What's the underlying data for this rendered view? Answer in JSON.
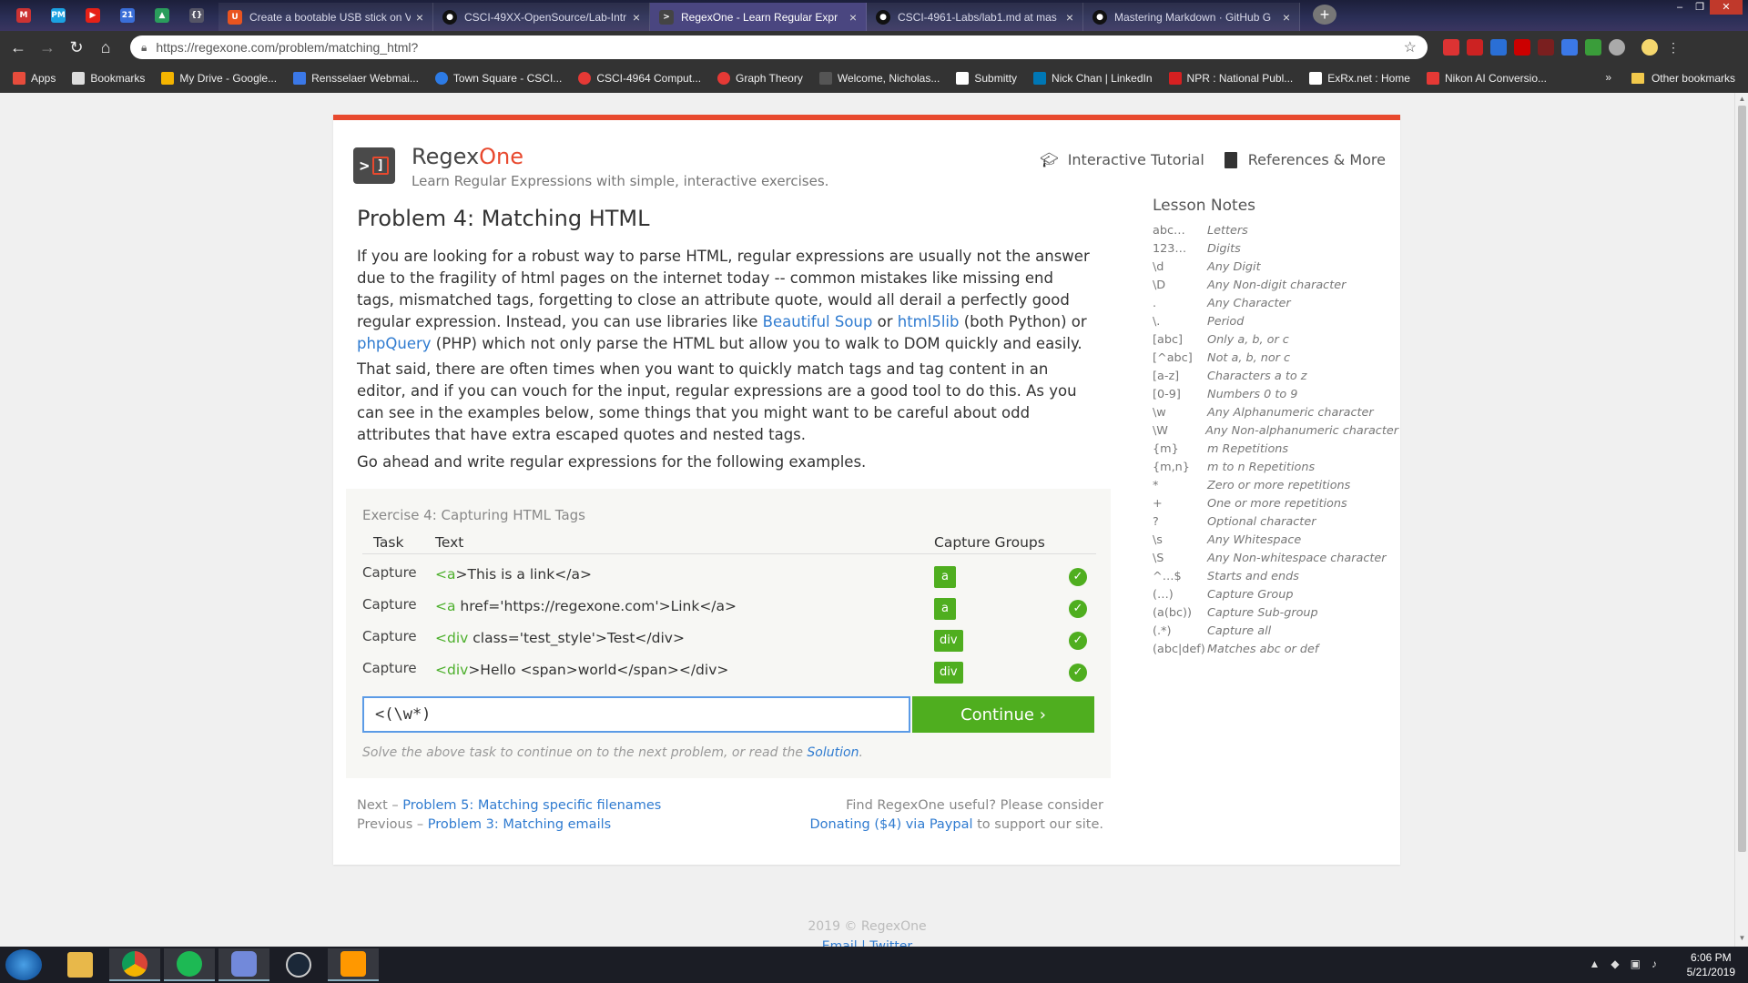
{
  "browser": {
    "tabs": [
      {
        "title": "Create a bootable USB stick on V"
      },
      {
        "title": "CSCI-49XX-OpenSource/Lab-Intr"
      },
      {
        "title": "RegexOne - Learn Regular Expr"
      },
      {
        "title": "CSCI-4961-Labs/lab1.md at mas"
      },
      {
        "title": "Mastering Markdown · GitHub G"
      }
    ],
    "pinned": [
      {
        "icon": "gmail-icon",
        "label": ""
      },
      {
        "icon": "pm-icon",
        "label": "PM"
      },
      {
        "icon": "youtube-icon",
        "label": ""
      },
      {
        "icon": "calendar-icon",
        "label": "21"
      },
      {
        "icon": "drive-icon",
        "label": ""
      },
      {
        "icon": "extension-icon",
        "label": ""
      }
    ],
    "url": "https://regexone.com/problem/matching_html?",
    "bookmarks": [
      {
        "label": "Apps",
        "color": "#e74c3c"
      },
      {
        "label": "Bookmarks",
        "color": "#dddddd"
      },
      {
        "label": "My Drive - Google...",
        "color": "#f4b400"
      },
      {
        "label": "Rensselaer Webmai...",
        "color": "#3b78e7"
      },
      {
        "label": "Town Square - CSCI...",
        "color": "#2d7be5"
      },
      {
        "label": "CSCI-4964 Comput...",
        "color": "#e53935"
      },
      {
        "label": "Graph Theory",
        "color": "#e53935"
      },
      {
        "label": "Welcome, Nicholas...",
        "color": "#555555"
      },
      {
        "label": "Submitty",
        "color": "#ffffff"
      },
      {
        "label": "Nick Chan | LinkedIn",
        "color": "#0077b5"
      },
      {
        "label": "NPR : National Publ...",
        "color": "#d62021"
      },
      {
        "label": "ExRx.net : Home",
        "color": "#ffffff"
      },
      {
        "label": "Nikon AI Conversio...",
        "color": "#e53935"
      }
    ],
    "bookmarks_more": "»",
    "other_bookmarks": "Other bookmarks"
  },
  "site": {
    "brand_regex": "Regex",
    "brand_one": "One",
    "tagline": "Learn Regular Expressions with simple, interactive exercises.",
    "nav": [
      {
        "label": "Interactive Tutorial",
        "icon": "graduation-cap-icon"
      },
      {
        "label": "References & More",
        "icon": "book-icon"
      }
    ],
    "accent": "#e8492e",
    "link_color": "#2f7bd0",
    "success_color": "#4fae1f"
  },
  "problem": {
    "title": "Problem 4: Matching HTML",
    "p1_a": "If you are looking for a robust way to parse HTML, regular expressions are usually not the answer due to the fragility of html pages on the internet today -- common mistakes like missing end tags, mismatched tags, forgetting to close an attribute quote, would all derail a perfectly good regular expression. Instead, you can use libraries like ",
    "link1": "Beautiful Soup",
    "p1_b": " or ",
    "link2": "html5lib",
    "p1_c": " (both Python) or ",
    "link3": "phpQuery",
    "p1_d": " (PHP) which not only parse the HTML but allow you to walk to DOM quickly and easily.",
    "p2": "That said, there are often times when you want to quickly match tags and tag content in an editor, and if you can vouch for the input, regular expressions are a good tool to do this. As you can see in the examples below, some things that you might want to be careful about odd attributes that have extra escaped quotes and nested tags.",
    "p3": "Go ahead and write regular expressions for the following examples."
  },
  "exercise": {
    "title": "Exercise 4: Capturing HTML Tags",
    "headers": {
      "task": "Task",
      "text": "Text",
      "groups": "Capture Groups"
    },
    "rows": [
      {
        "task": "Capture",
        "tag": "<a",
        "rest": ">This is a link</a>",
        "group": "a"
      },
      {
        "task": "Capture",
        "tag": "<a",
        "rest": " href='https://regexone.com'>Link</a>",
        "group": "a"
      },
      {
        "task": "Capture",
        "tag": "<div",
        "rest": " class='test_style'>Test</div>",
        "group": "div"
      },
      {
        "task": "Capture",
        "tag": "<div",
        "rest": ">Hello <span>world</span></div>",
        "group": "div"
      }
    ],
    "input_value": "<(\\w*)",
    "continue_label": "Continue ›",
    "hint_prefix": "Solve the above task to continue on to the next problem, or read the ",
    "hint_link": "Solution",
    "hint_suffix": "."
  },
  "footer": {
    "next_prefix": "Next – ",
    "next_link": "Problem 5: Matching specific filenames",
    "prev_prefix": "Previous – ",
    "prev_link": "Problem 3: Matching emails",
    "donate_line1": "Find RegexOne useful? Please consider",
    "donate_link": "Donating ($4) via Paypal",
    "donate_suffix": " to support our site.",
    "copyright": "2019 © RegexOne",
    "links": "Email | Twitter"
  },
  "notes": {
    "title": "Lesson Notes",
    "items": [
      {
        "k": "abc…",
        "v": "Letters"
      },
      {
        "k": "123…",
        "v": "Digits"
      },
      {
        "k": "\\d",
        "v": "Any Digit"
      },
      {
        "k": "\\D",
        "v": "Any Non-digit character"
      },
      {
        "k": ".",
        "v": "Any Character"
      },
      {
        "k": "\\.",
        "v": "Period"
      },
      {
        "k": "[abc]",
        "v": "Only a, b, or c"
      },
      {
        "k": "[^abc]",
        "v": "Not a, b, nor c"
      },
      {
        "k": "[a-z]",
        "v": "Characters a to z"
      },
      {
        "k": "[0-9]",
        "v": "Numbers 0 to 9"
      },
      {
        "k": "\\w",
        "v": "Any Alphanumeric character"
      },
      {
        "k": "\\W",
        "v": "Any Non-alphanumeric character"
      },
      {
        "k": "{m}",
        "v": "m Repetitions"
      },
      {
        "k": "{m,n}",
        "v": "m to n Repetitions"
      },
      {
        "k": "*",
        "v": "Zero or more repetitions"
      },
      {
        "k": "+",
        "v": "One or more repetitions"
      },
      {
        "k": "?",
        "v": "Optional character"
      },
      {
        "k": "\\s",
        "v": "Any Whitespace"
      },
      {
        "k": "\\S",
        "v": "Any Non-whitespace character"
      },
      {
        "k": "^…$",
        "v": "Starts and ends"
      },
      {
        "k": "(…)",
        "v": "Capture Group"
      },
      {
        "k": "(a(bc))",
        "v": "Capture Sub-group"
      },
      {
        "k": "(.*)",
        "v": "Capture all"
      },
      {
        "k": "(abc|def)",
        "v": "Matches abc or def"
      }
    ]
  },
  "taskbar": {
    "apps": [
      "explorer-icon",
      "chrome-icon",
      "spotify-icon",
      "discord-icon",
      "steam-icon",
      "sublime-icon"
    ],
    "time": "6:06 PM",
    "date": "5/21/2019"
  }
}
